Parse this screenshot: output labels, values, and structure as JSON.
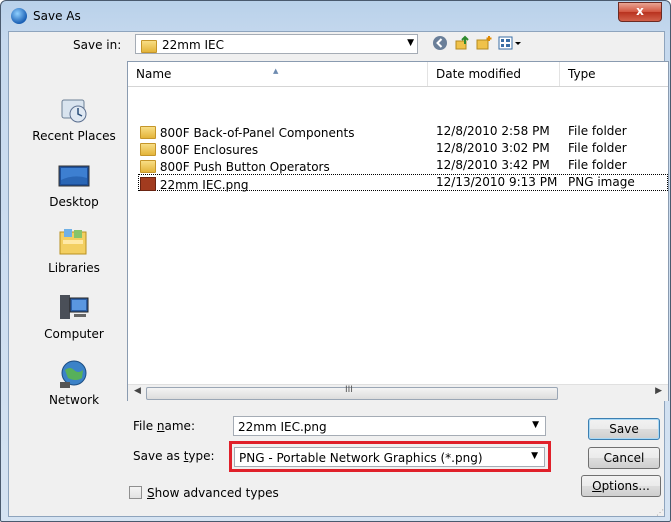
{
  "window": {
    "title": "Save As",
    "close_label": "x"
  },
  "save_in": {
    "label": "Save in:",
    "value": "22mm IEC"
  },
  "places": [
    {
      "label": "Recent Places"
    },
    {
      "label": "Desktop"
    },
    {
      "label": "Libraries"
    },
    {
      "label": "Computer"
    },
    {
      "label": "Network"
    }
  ],
  "columns": {
    "name": "Name",
    "date": "Date modified",
    "type": "Type"
  },
  "files": [
    {
      "name": "800F Back-of-Panel Components",
      "date": "12/8/2010 2:58 PM",
      "type": "File folder",
      "kind": "folder"
    },
    {
      "name": "800F Enclosures",
      "date": "12/8/2010 3:02 PM",
      "type": "File folder",
      "kind": "folder"
    },
    {
      "name": "800F Push Button Operators",
      "date": "12/8/2010 3:42 PM",
      "type": "File folder",
      "kind": "folder"
    },
    {
      "name": "22mm IEC.png",
      "date": "12/13/2010 9:13 PM",
      "type": "PNG image",
      "kind": "png"
    }
  ],
  "scroll_grip": "III",
  "file_name": {
    "label_pre": "File ",
    "label_u": "n",
    "label_post": "ame:",
    "value": "22mm IEC.png"
  },
  "save_as_type": {
    "label_pre": "Save as ",
    "label_u": "t",
    "label_post": "ype:",
    "value": "PNG - Portable Network Graphics (*.png)"
  },
  "buttons": {
    "save": "Save",
    "cancel": "Cancel",
    "options_u": "O",
    "options_rest": "ptions..."
  },
  "advanced": {
    "label_u": "S",
    "label_rest": "how advanced types"
  }
}
